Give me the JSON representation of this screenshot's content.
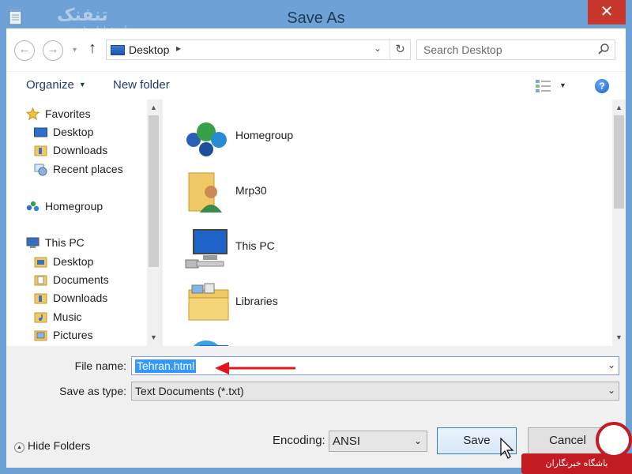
{
  "window": {
    "title": "Save As",
    "close_glyph": "✕",
    "watermark_text": "تنفنک",
    "watermark_sub": "آموزش ابزار برنامه نویسی"
  },
  "nav": {
    "back_glyph": "←",
    "forward_glyph": "→",
    "dropdown_glyph": "▾",
    "up_glyph": "↑",
    "address_crumb": "Desktop",
    "address_chevron": "▸",
    "address_dropdown": "⌄",
    "refresh_glyph": "↻",
    "search_placeholder": "Search Desktop"
  },
  "toolbar": {
    "organize_label": "Organize",
    "new_folder_label": "New folder",
    "caret_glyph": "▼",
    "help_glyph": "?"
  },
  "sidebar": {
    "items": [
      {
        "label": "Favorites",
        "icon": "star-icon"
      },
      {
        "label": "Desktop",
        "icon": "desktop-icon"
      },
      {
        "label": "Downloads",
        "icon": "downloads-folder-icon"
      },
      {
        "label": "Recent places",
        "icon": "recent-places-icon"
      },
      {
        "label": "Homegroup",
        "icon": "homegroup-icon"
      },
      {
        "label": "This PC",
        "icon": "computer-icon"
      },
      {
        "label": "Desktop",
        "icon": "folder-icon"
      },
      {
        "label": "Documents",
        "icon": "documents-folder-icon"
      },
      {
        "label": "Downloads",
        "icon": "downloads-folder-icon"
      },
      {
        "label": "Music",
        "icon": "music-folder-icon"
      },
      {
        "label": "Pictures",
        "icon": "pictures-folder-icon"
      }
    ]
  },
  "content": {
    "items": [
      {
        "label": "Homegroup",
        "icon": "homegroup-icon"
      },
      {
        "label": "Mrp30",
        "icon": "user-folder-icon"
      },
      {
        "label": "This PC",
        "icon": "computer-icon"
      },
      {
        "label": "Libraries",
        "icon": "libraries-folder-icon"
      },
      {
        "label": "",
        "icon": "network-icon"
      }
    ]
  },
  "scroll": {
    "up_glyph": "▲",
    "down_glyph": "▼"
  },
  "form": {
    "file_name_label": "File name:",
    "file_name_value": "Tehran.html",
    "save_type_label": "Save as type:",
    "save_type_value": "Text Documents (*.txt)",
    "dropdown_glyph": "⌄"
  },
  "footer": {
    "hide_folders_label": "Hide Folders",
    "hide_glyph": "▲",
    "encoding_label": "Encoding:",
    "encoding_value": "ANSI",
    "save_label": "Save",
    "cancel_label": "Cancel"
  },
  "brand": {
    "text": "باشگاه خبرنگاران"
  },
  "colors": {
    "title_bar": "#6ea2d6",
    "close_button": "#c7372d",
    "selection": "#3399ff",
    "arrow": "#e0161c",
    "brand_red": "#c21b22"
  }
}
